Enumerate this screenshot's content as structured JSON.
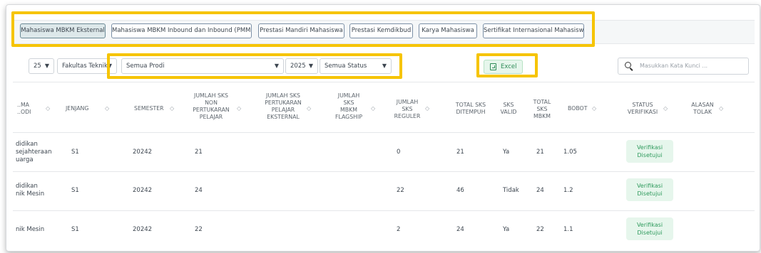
{
  "tabs": [
    {
      "label": "Mahasiswa MBKM Eksternal",
      "active": true
    },
    {
      "label": "Mahasiswa MBKM Inbound dan Inbound (PMM)",
      "active": false
    },
    {
      "label": "Prestasi Mandiri Mahasiswa",
      "active": false
    },
    {
      "label": "Prestasi Kemdikbud",
      "active": false
    },
    {
      "label": "Karya Mahasiswa",
      "active": false
    },
    {
      "label": "Sertifikat Internasional Mahasiswa",
      "active": false
    }
  ],
  "filters": {
    "page_size": "25",
    "fakultas": "Fakultas Teknik",
    "prodi": "Semua Prodi",
    "year": "2025",
    "status": "Semua Status"
  },
  "excel_label": "Excel",
  "search_placeholder": "Masukkan Kata Kunci ...",
  "columns": {
    "nama_prodi": [
      "..MA",
      "..ODI"
    ],
    "jenjang": [
      "JENJANG"
    ],
    "semester": [
      "SEMESTER"
    ],
    "sks_non_pertukaran": [
      "JUMLAH SKS",
      "NON",
      "PERTUKARAN",
      "PELAJAR"
    ],
    "sks_pertukaran": [
      "JUMLAH SKS",
      "PERTUKARAN",
      "PELAJAR",
      "EKSTERNAL"
    ],
    "sks_flagship": [
      "JUMLAH",
      "SKS",
      "MBKM",
      "FLAGSHIP"
    ],
    "sks_reguler": [
      "JUMLAH",
      "SKS",
      "REGULER"
    ],
    "total_ditempuh": [
      "TOTAL SKS",
      "DITEMPUH"
    ],
    "sks_valid": [
      "SKS",
      "VALID"
    ],
    "total_mbkm": [
      "TOTAL",
      "SKS",
      "MBKM"
    ],
    "bobot": [
      "BOBOT"
    ],
    "status_verifikasi": [
      "STATUS",
      "VERIFIKASI"
    ],
    "alasan_tolak": [
      "ALASAN",
      "TOLAK"
    ]
  },
  "rows": [
    {
      "prodi": [
        "didikan",
        "sejahteraan",
        "uarga"
      ],
      "jenjang": "S1",
      "semester": "20242",
      "sks_non_pertukaran": "21",
      "sks_pertukaran": "",
      "sks_flagship": "",
      "sks_reguler": "0",
      "total_ditempuh": "21",
      "sks_valid": "Ya",
      "total_mbkm": "21",
      "bobot": "1.05",
      "status": [
        "Verifikasi",
        "Disetujui"
      ],
      "alasan": ""
    },
    {
      "prodi": [
        "didikan",
        "nik Mesin"
      ],
      "jenjang": "S1",
      "semester": "20242",
      "sks_non_pertukaran": "24",
      "sks_pertukaran": "",
      "sks_flagship": "",
      "sks_reguler": "22",
      "total_ditempuh": "46",
      "sks_valid": "Tidak",
      "total_mbkm": "24",
      "bobot": "1.2",
      "status": [
        "Verifikasi",
        "Disetujui"
      ],
      "alasan": ""
    },
    {
      "prodi": [
        "nik Mesin"
      ],
      "jenjang": "S1",
      "semester": "20242",
      "sks_non_pertukaran": "22",
      "sks_pertukaran": "",
      "sks_flagship": "",
      "sks_reguler": "2",
      "total_ditempuh": "24",
      "sks_valid": "Ya",
      "total_mbkm": "22",
      "bobot": "1.1",
      "status": [
        "Verifikasi",
        "Disetujui"
      ],
      "alasan": ""
    }
  ],
  "colors": {
    "highlight": "#f6c400",
    "success_text": "#2e9a5c",
    "success_bg": "#e6f6ec",
    "active_tab_bg": "#dde8ea"
  }
}
